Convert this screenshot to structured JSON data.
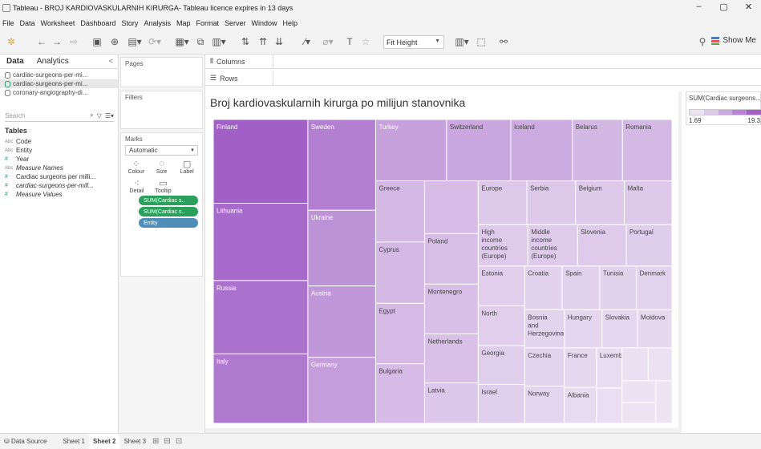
{
  "window": {
    "title": "Tableau - BROJ KARDIOVASKULARNIH KIRURGA- Tableau licence expires in 13 days",
    "controls": [
      "–",
      "▢",
      "✕"
    ]
  },
  "menu": [
    "File",
    "Data",
    "Worksheet",
    "Dashboard",
    "Story",
    "Analysis",
    "Map",
    "Format",
    "Server",
    "Window",
    "Help"
  ],
  "toolbar": {
    "fit": "Fit Height",
    "show_me": "Show Me"
  },
  "data_pane": {
    "tabs": [
      "Data",
      "Analytics"
    ],
    "collapse": "<",
    "sources": [
      "cardiac-surgeons-per-mi...",
      "cardiac-surgeons-per-mi...",
      "coronary-angiography-di..."
    ],
    "search_placeholder": "Search",
    "tables_heading": "Tables",
    "fields": [
      {
        "type": "Abc",
        "name": "Code",
        "italic": false
      },
      {
        "type": "Abc",
        "name": "Entity",
        "italic": false
      },
      {
        "type": "#",
        "name": "Year",
        "italic": false
      },
      {
        "type": "Abc",
        "name": "Measure Names",
        "italic": true
      },
      {
        "type": "#",
        "name": "Cardiac surgeons per milli...",
        "italic": false
      },
      {
        "type": "#",
        "name": "cardiac-surgeons-per-mill...",
        "italic": true
      },
      {
        "type": "#",
        "name": "Measure Values",
        "italic": true
      }
    ]
  },
  "cards": {
    "pages": "Pages",
    "filters": "Filters",
    "marks": "Marks",
    "mark_type": "Automatic",
    "buttons": [
      "Colour",
      "Size",
      "Label",
      "Detail",
      "Tooltip"
    ],
    "pills": [
      "SUM(Cardiac s..",
      "SUM(Cardiac s..",
      "Entity"
    ]
  },
  "shelves": {
    "columns": "Columns",
    "rows": "Rows"
  },
  "chart_title": "Broj kardiovaskularnih kirurga po milijun stanovnika",
  "legend": {
    "title": "SUM(Cardiac surgeons...",
    "min": "1.69",
    "max": "19.3"
  },
  "tabs_bottom": [
    "Data Source",
    "Sheet 1",
    "Sheet 2",
    "Sheet 3"
  ],
  "chart_data": {
    "type": "treemap",
    "title": "Broj kardiovaskularnih kirurga po milijun stanovnika",
    "value_label": "SUM(Cardiac surgeons per million)",
    "color_range": [
      1.69,
      19.3
    ],
    "leaves": [
      {
        "label": "Finland",
        "value": 19.3
      },
      {
        "label": "Lithuania",
        "value": 17.8
      },
      {
        "label": "Russia",
        "value": 16.9
      },
      {
        "label": "Italy",
        "value": 16.0
      },
      {
        "label": "Sweden",
        "value": 15.0
      },
      {
        "label": "Ukraine",
        "value": 12.5
      },
      {
        "label": "Austria",
        "value": 11.8
      },
      {
        "label": "Germany",
        "value": 10.9
      },
      {
        "label": "Turkey",
        "value": 10.6
      },
      {
        "label": "Switzerland",
        "value": 9.6
      },
      {
        "label": "Iceland",
        "value": 9.2
      },
      {
        "label": "Belarus",
        "value": 7.5
      },
      {
        "label": "Greece",
        "value": 7.3
      },
      {
        "label": "Bulgaria",
        "value": 7.1
      },
      {
        "label": "Cyprus",
        "value": 7.3
      },
      {
        "label": "Egypt",
        "value": 7.2
      },
      {
        "label": "",
        "value": 6.9
      },
      {
        "label": "Romania",
        "value": 7.4
      },
      {
        "label": "Poland",
        "value": 6.6
      },
      {
        "label": "Montenegro",
        "value": 6.5
      },
      {
        "label": "Netherlands",
        "value": 6.4
      },
      {
        "label": "Europe",
        "value": 5.2
      },
      {
        "label": "Latvia",
        "value": 5.3
      },
      {
        "label": "Serbia",
        "value": 5.2
      },
      {
        "label": "Malta",
        "value": 5.1
      },
      {
        "label": "High income countries (Europe)",
        "value": 5.0
      },
      {
        "label": "Middle income countries (Europe)",
        "value": 5.0
      },
      {
        "label": "Belgium",
        "value": 5.2
      },
      {
        "label": "Slovenia",
        "value": 4.9
      },
      {
        "label": "Portugal",
        "value": 4.6
      },
      {
        "label": "Estonia",
        "value": 4.5
      },
      {
        "label": "Georgia",
        "value": 4.4
      },
      {
        "label": "Israel",
        "value": 4.4
      },
      {
        "label": "North",
        "value": 4.5
      },
      {
        "label": "Croatia",
        "value": 4.0
      },
      {
        "label": "Spain",
        "value": 4.0
      },
      {
        "label": "Tunisia",
        "value": 3.9
      },
      {
        "label": "Bosnia and Herzegovina",
        "value": 3.7
      },
      {
        "label": "Czechia",
        "value": 3.7
      },
      {
        "label": "Norway",
        "value": 3.6
      },
      {
        "label": "Denmark",
        "value": 3.8
      },
      {
        "label": "Hungary",
        "value": 3.5
      },
      {
        "label": "Slovakia",
        "value": 3.3
      },
      {
        "label": "Moldova",
        "value": 3.2
      },
      {
        "label": "France",
        "value": 3.1
      },
      {
        "label": "Albania",
        "value": 2.8
      },
      {
        "label": "Luxembourg",
        "value": 2.5
      },
      {
        "label": "",
        "value": 2.2
      },
      {
        "label": "",
        "value": 2.1
      },
      {
        "label": "",
        "value": 1.9
      },
      {
        "label": "",
        "value": 1.8
      },
      {
        "label": "",
        "value": 1.7
      },
      {
        "label": "",
        "value": 1.69
      }
    ]
  }
}
